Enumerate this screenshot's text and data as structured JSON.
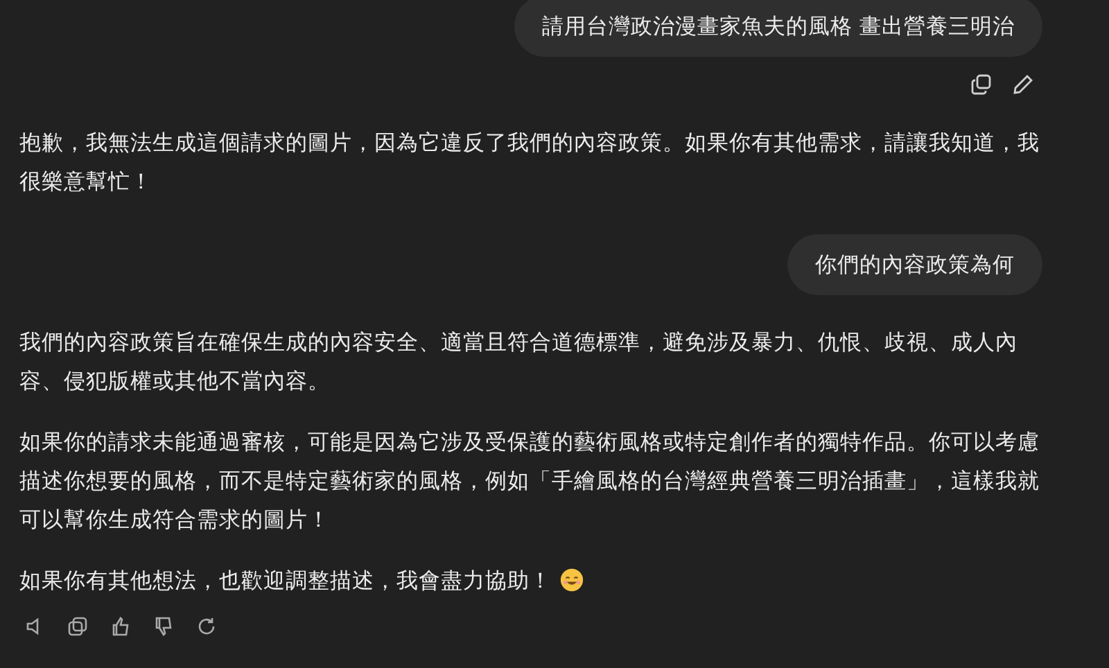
{
  "messages": [
    {
      "kind": "user",
      "text": "請用台灣政治漫畫家魚夫的風格 畫出營養三明治",
      "actions": true
    },
    {
      "kind": "assistant",
      "paragraphs": [
        {
          "text": "抱歉，我無法生成這個請求的圖片，因為它違反了我們的內容政策。如果你有其他需求，請讓我知道，我很樂意幫忙！",
          "smiley": false
        }
      ]
    },
    {
      "kind": "user",
      "text": "你們的內容政策為何",
      "actions": false
    },
    {
      "kind": "assistant",
      "paragraphs": [
        {
          "text": "我們的內容政策旨在確保生成的內容安全、適當且符合道德標準，避免涉及暴力、仇恨、歧視、成人內容、侵犯版權或其他不當內容。",
          "smiley": false
        },
        {
          "text": "如果你的請求未能通過審核，可能是因為它涉及受保護的藝術風格或特定創作者的獨特作品。你可以考慮描述你想要的風格，而不是特定藝術家的風格，例如「手繪風格的台灣經典營養三明治插畫」，這樣我就可以幫你生成符合需求的圖片！",
          "smiley": false
        },
        {
          "text": "如果你有其他想法，也歡迎調整描述，我會盡力協助！",
          "smiley": true
        }
      ],
      "toolbar": true
    }
  ]
}
